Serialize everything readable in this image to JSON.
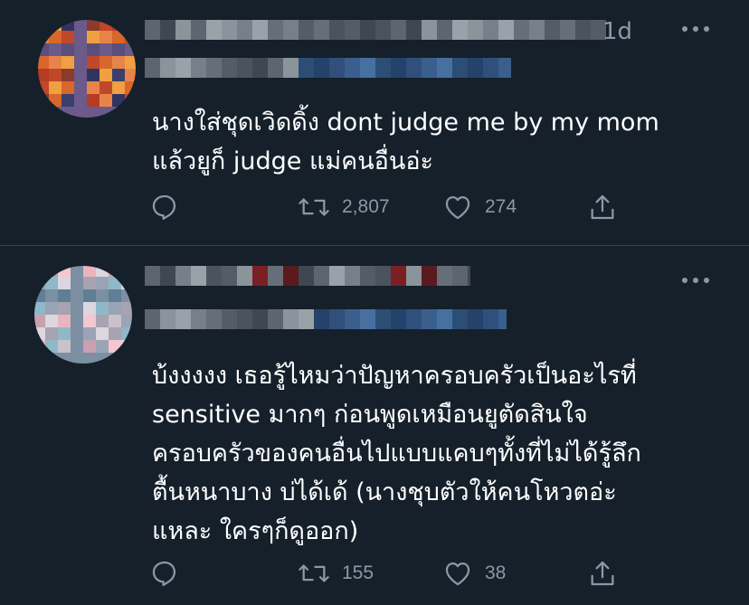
{
  "tweets": [
    {
      "time": "1d",
      "text_lines": [
        "นางใส่ชุดเวิดดิ้ง dont judge me by my mom",
        "แล้วยูก็ judge แม่คนอื่นอ่ะ"
      ],
      "retweets": "2,807",
      "likes": "274"
    },
    {
      "time": "",
      "text_lines": [
        "บ้งงงงง เธอรู้ไหมว่าปัญหาครอบครัวเป็นอะไรที่",
        "sensitive มากๆ ก่อนพูดเหมือนยูตัดสินใจ",
        "ครอบครัวของคนอื่นไปแบบแคบๆทั้งที่ไม่ได้รู้ลึก",
        "ตื้นหนาบาง บ่ได้เด้ (นางชุบตัวให้คนโหวตอ่ะ",
        "แหละ ใครๆก็ดูออก)"
      ],
      "retweets": "155",
      "likes": "38"
    }
  ],
  "icons": {
    "reply": "reply-icon",
    "retweet": "retweet-icon",
    "like": "heart-icon",
    "share": "share-icon",
    "more": "more-icon"
  },
  "colors": {
    "background": "#15202b",
    "muted": "#8b98a5",
    "divider": "#38444d",
    "text": "#ffffff"
  }
}
